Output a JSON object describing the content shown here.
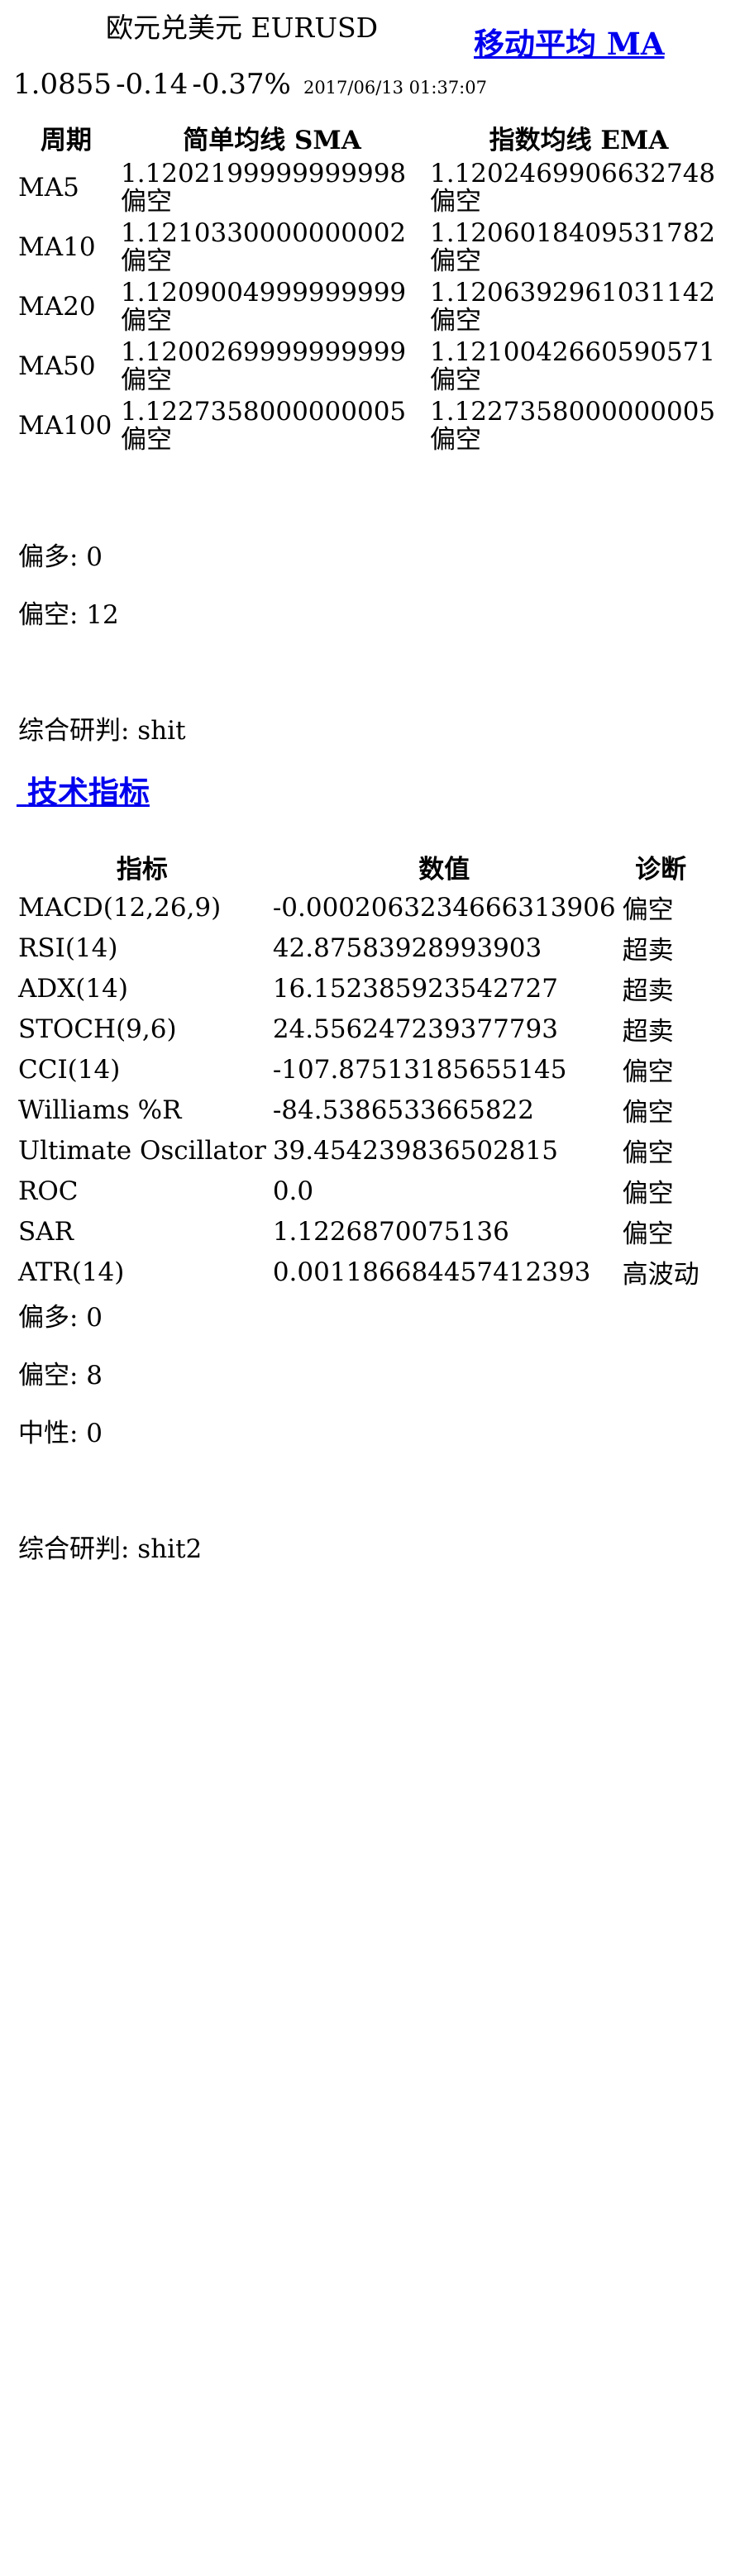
{
  "header": {
    "pair_title": "欧元兑美元 EURUSD",
    "ma_link_label": "移动平均 MA",
    "price": "1.0855",
    "change": "-0.14",
    "change_pct": "-0.37%",
    "timestamp": "2017/06/13 01:37:07"
  },
  "ma_table": {
    "headers": [
      "周期",
      "简单均线 SMA",
      "指数均线 EMA"
    ],
    "rows": [
      {
        "period": "MA5",
        "sma": "1.1202199999999998",
        "sma_diag": "偏空",
        "ema": "1.1202469906632748",
        "ema_diag": "偏空"
      },
      {
        "period": "MA10",
        "sma": "1.1210330000000002",
        "sma_diag": "偏空",
        "ema": "1.1206018409531782",
        "ema_diag": "偏空"
      },
      {
        "period": "MA20",
        "sma": "1.1209004999999999",
        "sma_diag": "偏空",
        "ema": "1.1206392961031142",
        "ema_diag": "偏空"
      },
      {
        "period": "MA50",
        "sma": "1.1200269999999999",
        "sma_diag": "偏空",
        "ema": "1.1210042660590571",
        "ema_diag": "偏空"
      },
      {
        "period": "MA100",
        "sma": "1.1227358000000005",
        "sma_diag": "偏空",
        "ema": "1.1227358000000005",
        "ema_diag": "偏空"
      }
    ]
  },
  "ma_summary": {
    "bull": "偏多: 0",
    "bear": "偏空: 12",
    "verdict": "综合研判:  shit"
  },
  "tech_link_label": "技术指标",
  "indicators": {
    "headers": [
      "指标",
      "数值",
      "诊断"
    ],
    "rows": [
      {
        "name": "MACD(12,26,9)",
        "value": "-0.0002063234666313906",
        "diag": "偏空"
      },
      {
        "name": "RSI(14)",
        "value": "42.87583928993903",
        "diag": "超卖"
      },
      {
        "name": "ADX(14)",
        "value": "16.152385923542727",
        "diag": "超卖"
      },
      {
        "name": "STOCH(9,6)",
        "value": "24.556247239377793",
        "diag": "超卖"
      },
      {
        "name": "CCI(14)",
        "value": "-107.87513185655145",
        "diag": "偏空"
      },
      {
        "name": "Williams %R",
        "value": "-84.5386533665822",
        "diag": "偏空"
      },
      {
        "name": "Ultimate Oscillator",
        "value": "39.454239836502815",
        "diag": "偏空"
      },
      {
        "name": "ROC",
        "value": "0.0",
        "diag": "偏空"
      },
      {
        "name": "SAR",
        "value": "1.1226870075136",
        "diag": "偏空"
      },
      {
        "name": "ATR(14)",
        "value": "0.0011866844574123​93",
        "diag": "高波动"
      }
    ]
  },
  "tech_summary": {
    "bull": "偏多: 0",
    "bear": "偏空: 8",
    "neutral": "中性: 0",
    "verdict": "综合研判:  shit2"
  },
  "colors": {
    "link": "#0000ee",
    "text": "#000000",
    "background": "#ffffff"
  }
}
